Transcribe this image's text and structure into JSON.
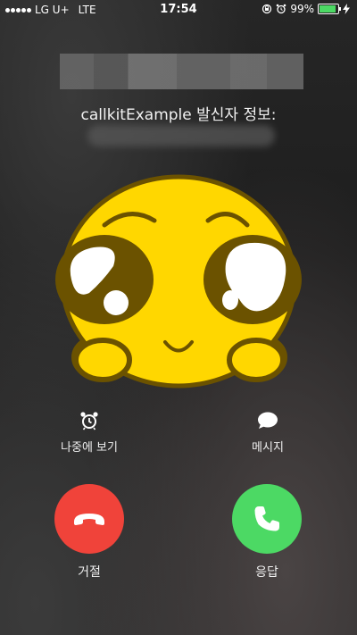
{
  "status_bar": {
    "carrier": "LG U+",
    "network": "LTE",
    "time": "17:54",
    "battery": "99%",
    "battery_level": 0.99,
    "signal_dots": 5
  },
  "caller": {
    "subtitle": "callkitExample 발신자 정보:"
  },
  "actions": {
    "remind_label": "나중에 보기",
    "message_label": "메시지",
    "decline_label": "거절",
    "accept_label": "응답"
  },
  "colors": {
    "decline": "#f0433a",
    "accept": "#4cd964",
    "avatar_face": "#ffd700",
    "avatar_outline": "#6b5200"
  },
  "icons": {
    "remind": "alarm-clock-icon",
    "message": "speech-bubble-icon",
    "decline": "phone-hangup-icon",
    "accept": "phone-icon"
  }
}
